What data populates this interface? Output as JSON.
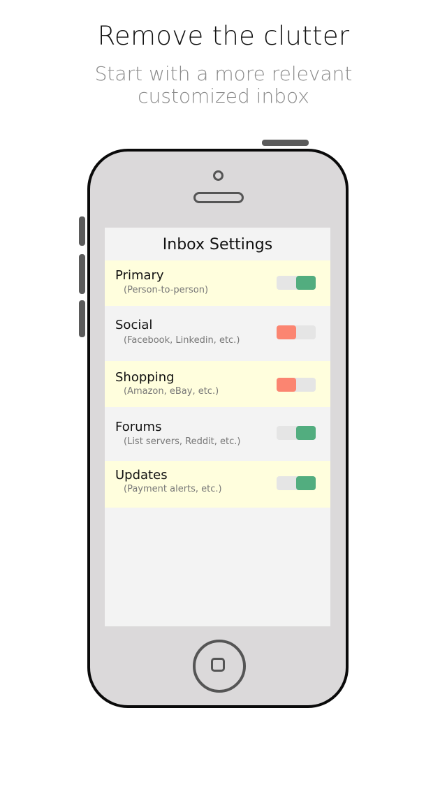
{
  "promo": {
    "title": "Remove the clutter",
    "subtitle_lines": [
      "Start with a more relevant",
      "customized inbox"
    ]
  },
  "screen": {
    "title": "Inbox Settings",
    "settings": [
      {
        "label": "Primary",
        "description": "(Person-to-person)",
        "enabled": true,
        "highlighted": true
      },
      {
        "label": "Social",
        "description": "(Facebook, Linkedin, etc.)",
        "enabled": false,
        "highlighted": false
      },
      {
        "label": "Shopping",
        "description": "(Amazon, eBay, etc.)",
        "enabled": false,
        "highlighted": true
      },
      {
        "label": "Forums",
        "description": "(List servers, Reddit, etc.)",
        "enabled": true,
        "highlighted": false
      },
      {
        "label": "Updates",
        "description": "(Payment alerts, etc.)",
        "enabled": true,
        "highlighted": true
      }
    ]
  },
  "colors": {
    "toggle_on": "#52ad7f",
    "toggle_off": "#fb8571",
    "row_highlight": "#fffedd",
    "screen_background": "#f3f3f3",
    "phone_body": "#dbd9da"
  }
}
